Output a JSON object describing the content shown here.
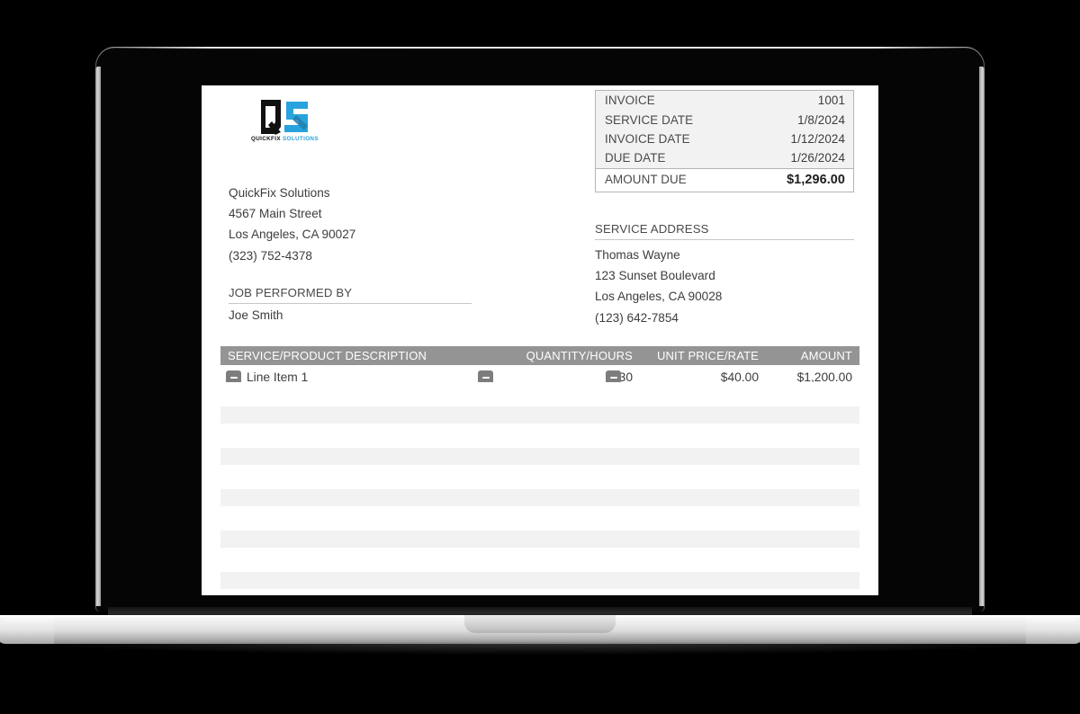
{
  "device": {
    "type": "laptop-mockup",
    "frame_color": "#050505",
    "base_color": "#dcdcdc"
  },
  "document": {
    "logo": {
      "icon_name": "quickfix-solutions-logo",
      "mark_q_color": "#111111",
      "mark_s_color": "#2aa3dd",
      "wordmark_q": "QUICKFIX",
      "wordmark_s": "SOLUTIONS"
    },
    "company": {
      "lines": [
        "QuickFix Solutions",
        "4567 Main Street",
        "Los Angeles, CA 90027",
        "(323) 752-4378"
      ]
    },
    "job_performed_by": {
      "label": "JOB PERFORMED BY",
      "value": "Joe Smith"
    },
    "info_box": {
      "rows": [
        {
          "label": "INVOICE",
          "value": "1001"
        },
        {
          "label": "SERVICE DATE",
          "value": "1/8/2024"
        },
        {
          "label": "INVOICE DATE",
          "value": "1/12/2024"
        },
        {
          "label": "DUE DATE",
          "value": "1/26/2024"
        }
      ],
      "total": {
        "label": "AMOUNT DUE",
        "value": "$1,296.00"
      }
    },
    "service_address": {
      "label": "SERVICE ADDRESS",
      "lines": [
        "Thomas Wayne",
        "123 Sunset Boulevard",
        "Los Angeles, CA 90028",
        "(123) 642-7854"
      ]
    },
    "items_table": {
      "header_bg": "#949494",
      "columns": [
        "SERVICE/PRODUCT DESCRIPTION",
        "QUANTITY/HOURS",
        "UNIT PRICE/RATE",
        "AMOUNT"
      ],
      "rows": [
        {
          "description": "Line Item 1",
          "quantity": "30",
          "unit_price": "$40.00",
          "amount": "$1,200.00",
          "collapse_icon": "minus-icon"
        }
      ],
      "empty_row_count": 5,
      "empty_row_bg": "#f2f2f2"
    }
  }
}
